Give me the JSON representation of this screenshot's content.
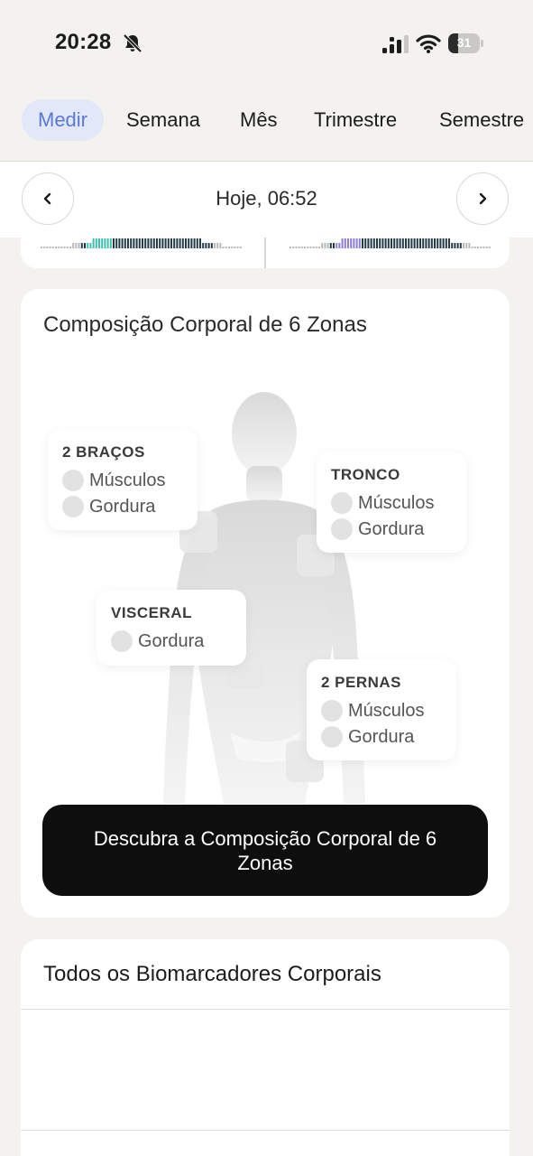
{
  "status_bar": {
    "time": "20:28",
    "battery_level": "31",
    "battery_fraction": 0.31,
    "icons": [
      "bell-slash-icon",
      "cellular-signal-icon",
      "wifi-icon",
      "battery-icon"
    ]
  },
  "tabs": {
    "items": [
      {
        "label": "Medir",
        "active": true
      },
      {
        "label": "Semana",
        "active": false
      },
      {
        "label": "Mês",
        "active": false
      },
      {
        "label": "Trimestre",
        "active": false
      },
      {
        "label": "Semestre",
        "active": false
      }
    ]
  },
  "date_nav": {
    "label": "Hoje, 06:52",
    "prev_icon": "chevron-left-icon",
    "next_icon": "chevron-right-icon"
  },
  "body_composition": {
    "title": "Composição Corporal de 6 Zonas",
    "zones": {
      "arms": {
        "title": "2 BRAÇOS",
        "items": [
          "Músculos",
          "Gordura"
        ]
      },
      "trunk": {
        "title": "TRONCO",
        "items": [
          "Músculos",
          "Gordura"
        ]
      },
      "visceral": {
        "title": "VISCERAL",
        "items": [
          "Gordura"
        ]
      },
      "legs": {
        "title": "2 PERNAS",
        "items": [
          "Músculos",
          "Gordura"
        ]
      }
    },
    "cta_label": "Descubra a Composição Corporal de 6 Zonas"
  },
  "biomarkers": {
    "title": "Todos os Biomarcadores Corporais"
  },
  "colors": {
    "background": "#f3f2ef",
    "tab_active_bg": "#e2e8f8",
    "tab_active_text": "#5a78d6",
    "cta_bg": "#0e0e0e",
    "teal_accent": "#3fbfb0",
    "purple_accent": "#8b7fd9"
  }
}
